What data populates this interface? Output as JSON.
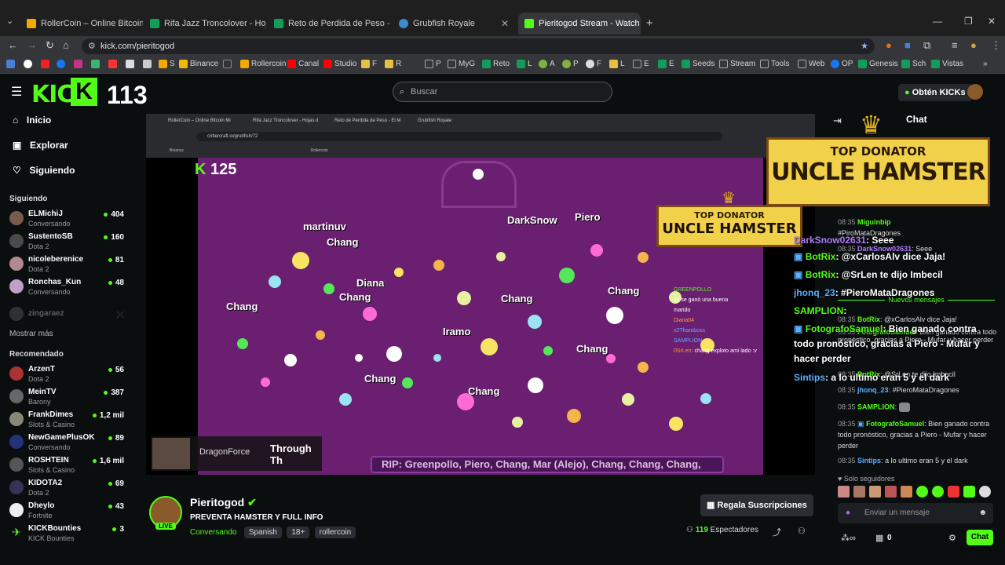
{
  "browser": {
    "tabs": [
      {
        "title": "RollerCoin – Online Bitcoin Mi",
        "color": "#f2a900"
      },
      {
        "title": "Rifa Jazz Troncolover - Hojas de",
        "color": "#0f9d58"
      },
      {
        "title": "Reto de Perdida de Peso - El M",
        "color": "#0f9d58"
      },
      {
        "title": "Grubfish Royale",
        "color": "#3c8cc8"
      },
      {
        "title": "Pieritogod Stream - Watch",
        "color": "#53fc18"
      }
    ],
    "url": "kick.com/pieritogod",
    "bookmarks": [
      "Binance",
      "Rollercoin",
      "Canal",
      "Studio",
      "F",
      "R",
      "P",
      "MyG",
      "Reto",
      "L",
      "A",
      "P",
      "F",
      "L",
      "E",
      "E",
      "Seeds",
      "Stream",
      "Tools",
      "Web",
      "OP",
      "Genesis",
      "Sch",
      "Vistas"
    ]
  },
  "header": {
    "logo": "KICK",
    "badge": "K",
    "counter": "113",
    "search_placeholder": "Buscar",
    "get_kicks": "Obtén KICKs"
  },
  "sidebar": {
    "nav": [
      "Inicio",
      "Explorar",
      "Siguiendo"
    ],
    "following_title": "Siguiendo",
    "following": [
      {
        "name": "ELMichiJ",
        "sub": "Conversando",
        "viewers": "404"
      },
      {
        "name": "SustentoSB",
        "sub": "Dota 2",
        "viewers": "160"
      },
      {
        "name": "nicoleberenice",
        "sub": "Dota 2",
        "viewers": "81"
      },
      {
        "name": "Ronchas_Kun",
        "sub": "Conversando",
        "viewers": "48"
      }
    ],
    "offline": "zingaraez",
    "show_more": "Mostrar más",
    "recommended_title": "Recomendado",
    "recommended": [
      {
        "name": "ArzenT",
        "sub": "Dota 2",
        "viewers": "56"
      },
      {
        "name": "MeinTV",
        "sub": "Barony",
        "viewers": "387"
      },
      {
        "name": "FrankDimes",
        "sub": "Slots & Casino",
        "viewers": "1,2 mil"
      },
      {
        "name": "NewGamePlusOK",
        "sub": "Conversando",
        "viewers": "89"
      },
      {
        "name": "ROSHTEIN",
        "sub": "Slots & Casino",
        "viewers": "1,6 mil"
      },
      {
        "name": "KIDOTA2",
        "sub": "Dota 2",
        "viewers": "69"
      },
      {
        "name": "Dheylo",
        "sub": "Fortnite",
        "viewers": "43"
      },
      {
        "name": "KICKBounties",
        "sub": "KICK Bounties",
        "viewers": "3"
      }
    ]
  },
  "stream": {
    "inner_url": "crittercraft.io/grubfish/72",
    "inner_tabs": [
      "RollerCoin – Online Bitcoin Mi",
      "Rifa Jazz Troncolover - Hojas d",
      "Reto de Perdida de Peso - El M",
      "Grubfish Royale"
    ],
    "score": "125",
    "players": [
      "martinuv",
      "Chang",
      "Diana",
      "Chang",
      "DarkSnow",
      "Piero",
      "Chang",
      "Chang",
      "Iramo",
      "Chang",
      "Chang",
      "Chang",
      "Chang"
    ],
    "rip": "RIP:   Greenpollo, Piero, Chang, Mar (Alejo), Chang, Chang, Chang,",
    "music_artist": "DragonForce",
    "music_title": "Through Th",
    "overlay_chat": [
      {
        "user": "GREENPOLLO",
        "text": ""
      },
      {
        "user": "",
        "text": "ya se ganó una buena"
      },
      {
        "user": "marido",
        "text": ""
      },
      {
        "user": "Diana04",
        "text": ""
      },
      {
        "user": "s2Thamboss",
        "text": ""
      },
      {
        "user": "SAMPLION",
        "text": ""
      },
      {
        "user": "0SrLen",
        "text": ": chang exploto ami lado :v"
      }
    ],
    "donator_top": "TOP DONATOR",
    "donator_name": "UNCLE HAMSTER"
  },
  "chat": {
    "title": "Chat",
    "messages": [
      {
        "time": "08:35",
        "user": "Miguinbip",
        "text": ""
      },
      {
        "time": "",
        "user": "",
        "text": "#PiroMataDragones"
      },
      {
        "time": "08:35",
        "user": "DarkSnow02631",
        "text": ": Seee"
      },
      {
        "time": "08:35",
        "user": "BotRix",
        "text": ": @xCarlosAlv dice Jaja!"
      },
      {
        "time": "08:35",
        "user": "FotografoSamuel",
        "text": ": Bien ganado contra todo pronóstico, gracias a Piero - Mufar y hacer perder"
      },
      {
        "time": "08:35",
        "user": "BotRix",
        "text": ": @SrLen te dijo Imbecil"
      },
      {
        "time": "08:35",
        "user": "jhonq_23",
        "text": ": #PieroMataDragones"
      },
      {
        "time": "08:35",
        "user": "SAMPLION",
        "text": ":"
      },
      {
        "time": "08:35",
        "user": "FotografoSamuel",
        "text": ": Bien ganado contra todo pronóstico, gracias a Piero - Mufar y hacer perder"
      },
      {
        "time": "08:35",
        "user": "Sintips",
        "text": ": a lo ultimo eran 5 y el dark"
      }
    ],
    "tts": [
      {
        "user": "DarkSnow02631",
        "text": ": Seee"
      },
      {
        "user": "BotRix",
        "text": ": @xCarlosAlv dice Jaja!"
      },
      {
        "user": "BotRix",
        "text": ": @SrLen te dijo Imbecil"
      },
      {
        "user": "jhonq_23",
        "text": ": #PieroMataDragones"
      },
      {
        "user": "SAMPLION",
        "text": ":"
      },
      {
        "user": "FotografoSamuel",
        "text": ": Bien ganado contra todo pronóstico, gracias a Piero - Mufar y hacer perder"
      },
      {
        "user": "Sintips",
        "text": ": a lo ultimo eran 5 y el dark"
      }
    ],
    "new_messages": "Nuevos mensajes",
    "followers_only": "Solo seguidores",
    "input_placeholder": "Enviar un mensaje",
    "points": "0",
    "send": "Chat"
  },
  "channel": {
    "name": "Pieritogod",
    "live": "LIVE",
    "title": "PREVENTA HAMSTER Y FULL INFO",
    "category": "Conversando",
    "tags": [
      "Spanish",
      "18+",
      "rollercoin"
    ],
    "gift_button": "Regala Suscripciones",
    "viewers": "119",
    "viewers_label": "Espectadores"
  }
}
